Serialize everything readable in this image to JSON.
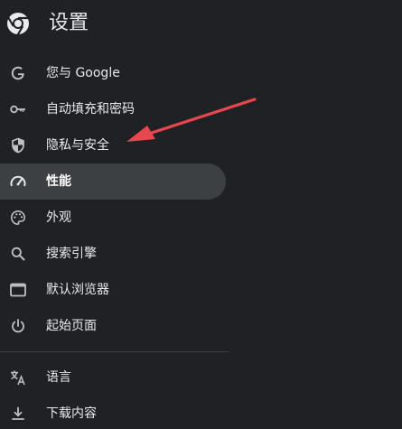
{
  "header": {
    "title": "设置",
    "logo_icon": "chrome-logo-icon"
  },
  "nav": {
    "items": [
      {
        "label": "您与 Google",
        "icon": "google-g-icon"
      },
      {
        "label": "自动填充和密码",
        "icon": "key-icon"
      },
      {
        "label": "隐私与安全",
        "icon": "shield-icon"
      },
      {
        "label": "性能",
        "icon": "speedometer-icon",
        "active": true
      },
      {
        "label": "外观",
        "icon": "palette-icon"
      },
      {
        "label": "搜索引擎",
        "icon": "search-icon"
      },
      {
        "label": "默认浏览器",
        "icon": "browser-window-icon"
      },
      {
        "label": "起始页面",
        "icon": "power-icon"
      }
    ],
    "items_after_divider": [
      {
        "label": "语言",
        "icon": "translate-icon"
      },
      {
        "label": "下载内容",
        "icon": "download-icon"
      }
    ]
  },
  "annotation": {
    "arrow_color": "#e8474f"
  },
  "colors": {
    "background": "#202124",
    "active_item": "#3c4043",
    "text": "#e8eaed",
    "icon": "#bdc1c6"
  }
}
